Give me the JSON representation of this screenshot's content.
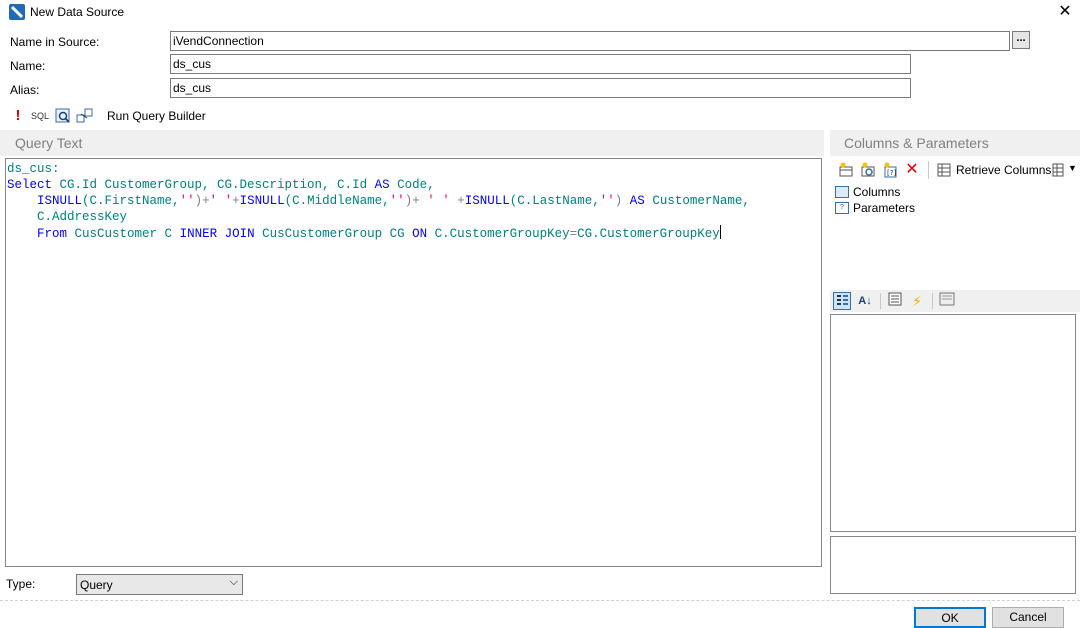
{
  "window": {
    "title": "New Data Source",
    "close_glyph": "✕"
  },
  "form": {
    "name_in_source_label": "Name in Source:",
    "name_in_source_value": "iVendConnection",
    "browse_label": "...",
    "name_label": "Name:",
    "name_value": "ds_cus",
    "alias_label": "Alias:",
    "alias_value": "ds_cus"
  },
  "toolbar": {
    "run_label": "!",
    "sql_label": "SQL",
    "run_query_builder_label": "Run Query Builder"
  },
  "query_text": {
    "header": "Query Text"
  },
  "columns_parameters": {
    "header": "Columns & Parameters",
    "retrieve_columns_label": "Retrieve Columns",
    "tree": [
      {
        "label": "Columns",
        "icon": "columns-icon"
      },
      {
        "label": "Parameters",
        "icon": "parameters-icon"
      }
    ]
  },
  "type": {
    "label": "Type:",
    "value": "Query"
  },
  "buttons": {
    "ok": "OK",
    "cancel": "Cancel"
  },
  "code_lines": [
    [
      {
        "t": "ds_cus:",
        "c": "teal"
      }
    ],
    [
      {
        "t": "Select ",
        "c": "blue"
      },
      {
        "t": "CG.Id CustomerGroup, CG.Description, C.Id ",
        "c": "teal"
      },
      {
        "t": "AS",
        "c": "blue"
      },
      {
        "t": " Code,",
        "c": "teal"
      }
    ],
    [
      {
        "t": "    ",
        "c": "teal"
      },
      {
        "t": "ISNULL",
        "c": "blue"
      },
      {
        "t": "(C.FirstName,",
        "c": "teal"
      },
      {
        "t": "''",
        "c": "pink"
      },
      {
        "t": ")+",
        "c": "gray"
      },
      {
        "t": "' '",
        "c": "pink"
      },
      {
        "t": "+",
        "c": "gray"
      },
      {
        "t": "ISNULL",
        "c": "blue"
      },
      {
        "t": "(C.MiddleName,",
        "c": "teal"
      },
      {
        "t": "''",
        "c": "pink"
      },
      {
        "t": ")+ ",
        "c": "gray"
      },
      {
        "t": "' '",
        "c": "pink"
      },
      {
        "t": " +",
        "c": "gray"
      },
      {
        "t": "ISNULL",
        "c": "blue"
      },
      {
        "t": "(C.LastName,",
        "c": "teal"
      },
      {
        "t": "''",
        "c": "pink"
      },
      {
        "t": ") ",
        "c": "gray"
      },
      {
        "t": "AS",
        "c": "blue"
      },
      {
        "t": " CustomerName,",
        "c": "teal"
      }
    ],
    [
      {
        "t": "    C.AddressKey",
        "c": "teal"
      }
    ],
    [
      {
        "t": "    ",
        "c": "teal"
      },
      {
        "t": "From",
        "c": "blue"
      },
      {
        "t": " CusCustomer C ",
        "c": "teal"
      },
      {
        "t": "INNER JOIN",
        "c": "blue"
      },
      {
        "t": " CusCustomerGroup CG ",
        "c": "teal"
      },
      {
        "t": "ON",
        "c": "blue"
      },
      {
        "t": " C.CustomerGroupKey",
        "c": "teal"
      },
      {
        "t": "=",
        "c": "gray"
      },
      {
        "t": "CG.CustomerGroupKey",
        "c": "teal"
      }
    ]
  ]
}
